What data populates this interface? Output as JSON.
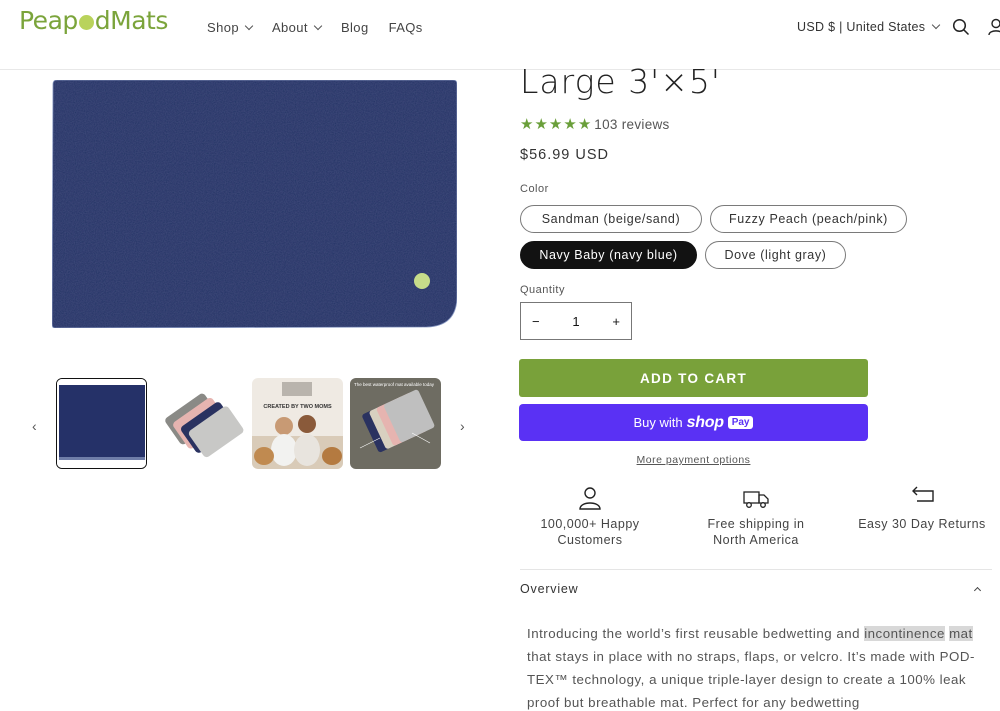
{
  "header": {
    "logo_a": "Peap",
    "logo_b": "dMats",
    "nav": [
      "Shop",
      "About",
      "Blog",
      "FAQs"
    ],
    "currency": "USD $ | United States"
  },
  "product": {
    "title": "Large 3'×5'",
    "rating": 5,
    "reviews": "103 reviews",
    "price": "$56.99 USD",
    "color_label": "Color",
    "colors": [
      "Sandman (beige/sand)",
      "Fuzzy Peach (peach/pink)",
      "Navy Baby (navy blue)",
      "Dove (light gray)"
    ],
    "selected_color": "Navy Baby (navy blue)",
    "quantity_label": "Quantity",
    "quantity": "1",
    "minus": "−",
    "plus": "+",
    "add_to_cart": "ADD TO CART",
    "buy_with": "Buy with",
    "shop_word": "shop",
    "pay_word": "Pay",
    "more_payment": "More payment options"
  },
  "features": [
    {
      "line1": "100,000+ Happy",
      "line2": "Customers",
      "icon": "user-icon"
    },
    {
      "line1": "Free shipping in",
      "line2": "North America",
      "icon": "truck-icon"
    },
    {
      "line1": "Easy 30 Day Returns",
      "line2": "",
      "icon": "return-arrow-icon"
    }
  ],
  "overview": {
    "label": "Overview",
    "desc_a": "Introducing the world’s first reusable bedwetting and ",
    "desc_hl1": "incontinence",
    "desc_hl2": "mat",
    "desc_b": " that stays in place with no straps, flaps, or velcro. It’s made with POD-TEX™ technology, a unique triple-layer design to create a 100% leak proof but breathable mat. Perfect for any bedwetting"
  },
  "thumbnails": {
    "t3_caption": "CREATED BY TWO MOMS",
    "t4_caption": "The best waterproof mat available today"
  },
  "colors": {
    "brand_green": "#79a13a",
    "navy": "#232a5c",
    "shop_pay": "#5a31f4"
  }
}
